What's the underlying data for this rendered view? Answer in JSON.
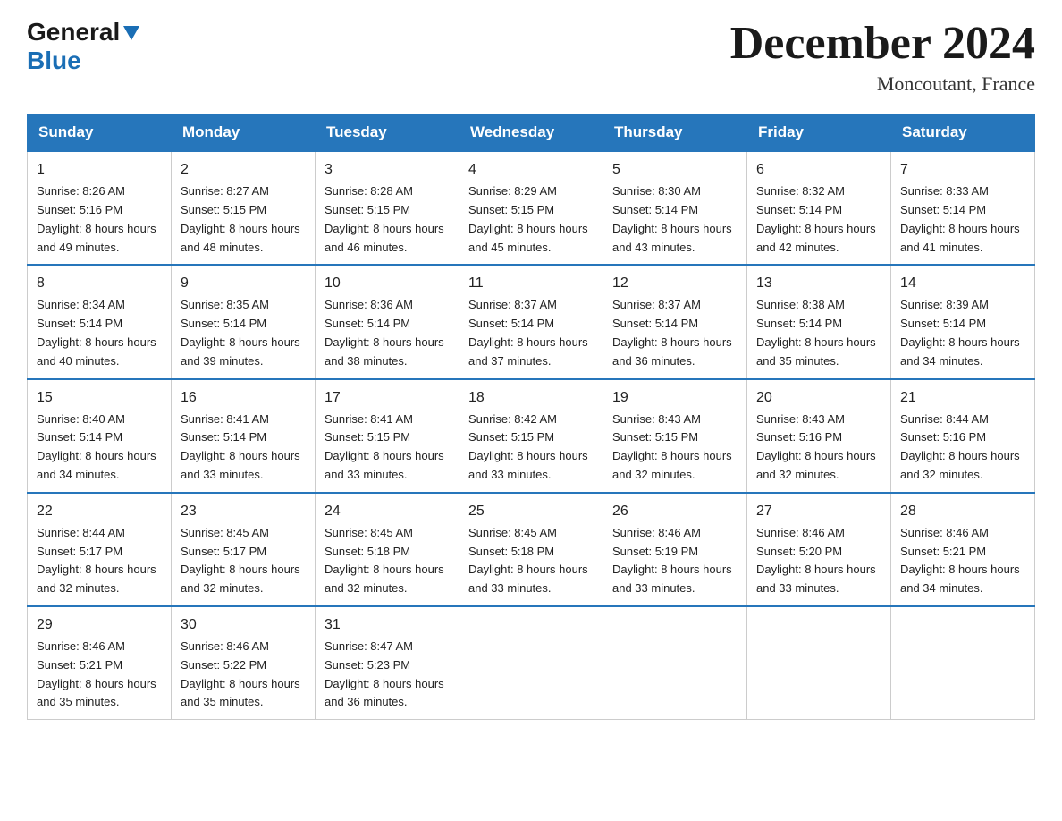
{
  "logo": {
    "text_general": "General",
    "text_blue": "Blue"
  },
  "calendar": {
    "title": "December 2024",
    "subtitle": "Moncoutant, France",
    "days_of_week": [
      "Sunday",
      "Monday",
      "Tuesday",
      "Wednesday",
      "Thursday",
      "Friday",
      "Saturday"
    ],
    "weeks": [
      [
        {
          "day": "1",
          "sunrise": "8:26 AM",
          "sunset": "5:16 PM",
          "daylight": "8 hours and 49 minutes."
        },
        {
          "day": "2",
          "sunrise": "8:27 AM",
          "sunset": "5:15 PM",
          "daylight": "8 hours and 48 minutes."
        },
        {
          "day": "3",
          "sunrise": "8:28 AM",
          "sunset": "5:15 PM",
          "daylight": "8 hours and 46 minutes."
        },
        {
          "day": "4",
          "sunrise": "8:29 AM",
          "sunset": "5:15 PM",
          "daylight": "8 hours and 45 minutes."
        },
        {
          "day": "5",
          "sunrise": "8:30 AM",
          "sunset": "5:14 PM",
          "daylight": "8 hours and 43 minutes."
        },
        {
          "day": "6",
          "sunrise": "8:32 AM",
          "sunset": "5:14 PM",
          "daylight": "8 hours and 42 minutes."
        },
        {
          "day": "7",
          "sunrise": "8:33 AM",
          "sunset": "5:14 PM",
          "daylight": "8 hours and 41 minutes."
        }
      ],
      [
        {
          "day": "8",
          "sunrise": "8:34 AM",
          "sunset": "5:14 PM",
          "daylight": "8 hours and 40 minutes."
        },
        {
          "day": "9",
          "sunrise": "8:35 AM",
          "sunset": "5:14 PM",
          "daylight": "8 hours and 39 minutes."
        },
        {
          "day": "10",
          "sunrise": "8:36 AM",
          "sunset": "5:14 PM",
          "daylight": "8 hours and 38 minutes."
        },
        {
          "day": "11",
          "sunrise": "8:37 AM",
          "sunset": "5:14 PM",
          "daylight": "8 hours and 37 minutes."
        },
        {
          "day": "12",
          "sunrise": "8:37 AM",
          "sunset": "5:14 PM",
          "daylight": "8 hours and 36 minutes."
        },
        {
          "day": "13",
          "sunrise": "8:38 AM",
          "sunset": "5:14 PM",
          "daylight": "8 hours and 35 minutes."
        },
        {
          "day": "14",
          "sunrise": "8:39 AM",
          "sunset": "5:14 PM",
          "daylight": "8 hours and 34 minutes."
        }
      ],
      [
        {
          "day": "15",
          "sunrise": "8:40 AM",
          "sunset": "5:14 PM",
          "daylight": "8 hours and 34 minutes."
        },
        {
          "day": "16",
          "sunrise": "8:41 AM",
          "sunset": "5:14 PM",
          "daylight": "8 hours and 33 minutes."
        },
        {
          "day": "17",
          "sunrise": "8:41 AM",
          "sunset": "5:15 PM",
          "daylight": "8 hours and 33 minutes."
        },
        {
          "day": "18",
          "sunrise": "8:42 AM",
          "sunset": "5:15 PM",
          "daylight": "8 hours and 33 minutes."
        },
        {
          "day": "19",
          "sunrise": "8:43 AM",
          "sunset": "5:15 PM",
          "daylight": "8 hours and 32 minutes."
        },
        {
          "day": "20",
          "sunrise": "8:43 AM",
          "sunset": "5:16 PM",
          "daylight": "8 hours and 32 minutes."
        },
        {
          "day": "21",
          "sunrise": "8:44 AM",
          "sunset": "5:16 PM",
          "daylight": "8 hours and 32 minutes."
        }
      ],
      [
        {
          "day": "22",
          "sunrise": "8:44 AM",
          "sunset": "5:17 PM",
          "daylight": "8 hours and 32 minutes."
        },
        {
          "day": "23",
          "sunrise": "8:45 AM",
          "sunset": "5:17 PM",
          "daylight": "8 hours and 32 minutes."
        },
        {
          "day": "24",
          "sunrise": "8:45 AM",
          "sunset": "5:18 PM",
          "daylight": "8 hours and 32 minutes."
        },
        {
          "day": "25",
          "sunrise": "8:45 AM",
          "sunset": "5:18 PM",
          "daylight": "8 hours and 33 minutes."
        },
        {
          "day": "26",
          "sunrise": "8:46 AM",
          "sunset": "5:19 PM",
          "daylight": "8 hours and 33 minutes."
        },
        {
          "day": "27",
          "sunrise": "8:46 AM",
          "sunset": "5:20 PM",
          "daylight": "8 hours and 33 minutes."
        },
        {
          "day": "28",
          "sunrise": "8:46 AM",
          "sunset": "5:21 PM",
          "daylight": "8 hours and 34 minutes."
        }
      ],
      [
        {
          "day": "29",
          "sunrise": "8:46 AM",
          "sunset": "5:21 PM",
          "daylight": "8 hours and 35 minutes."
        },
        {
          "day": "30",
          "sunrise": "8:46 AM",
          "sunset": "5:22 PM",
          "daylight": "8 hours and 35 minutes."
        },
        {
          "day": "31",
          "sunrise": "8:47 AM",
          "sunset": "5:23 PM",
          "daylight": "8 hours and 36 minutes."
        },
        null,
        null,
        null,
        null
      ]
    ],
    "labels": {
      "sunrise": "Sunrise: ",
      "sunset": "Sunset: ",
      "daylight": "Daylight: "
    }
  }
}
